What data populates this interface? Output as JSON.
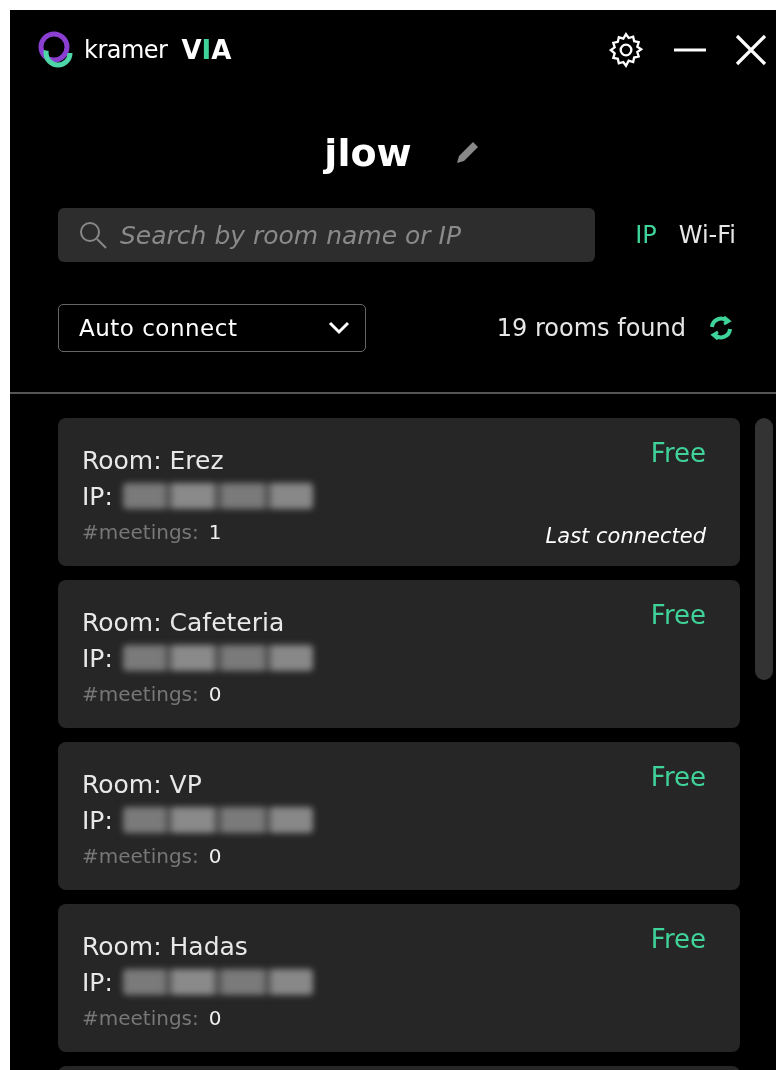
{
  "logo": {
    "brand": "kramer",
    "product": [
      {
        "text": "V",
        "accent": false
      },
      {
        "text": "I",
        "accent": true
      },
      {
        "text": "A",
        "accent": false
      }
    ]
  },
  "user": {
    "name": "jlow"
  },
  "search": {
    "placeholder": "Search by room name or IP"
  },
  "tabs": [
    {
      "label": "IP",
      "selected": true
    },
    {
      "label": "Wi-Fi",
      "selected": false
    }
  ],
  "connect_mode": {
    "value": "Auto connect"
  },
  "rooms_found": "19 rooms found",
  "rooms": [
    {
      "room_label": "Room:",
      "name": "Erez",
      "ip_label": "IP:",
      "meetings_label": "#meetings:",
      "meetings": "1",
      "status": "Free",
      "note": "Last connected"
    },
    {
      "room_label": "Room:",
      "name": "Cafeteria",
      "ip_label": "IP:",
      "meetings_label": "#meetings:",
      "meetings": "0",
      "status": "Free"
    },
    {
      "room_label": "Room:",
      "name": "VP",
      "ip_label": "IP:",
      "meetings_label": "#meetings:",
      "meetings": "0",
      "status": "Free"
    },
    {
      "room_label": "Room:",
      "name": "Hadas",
      "ip_label": "IP:",
      "meetings_label": "#meetings:",
      "meetings": "0",
      "status": "Free"
    }
  ]
}
